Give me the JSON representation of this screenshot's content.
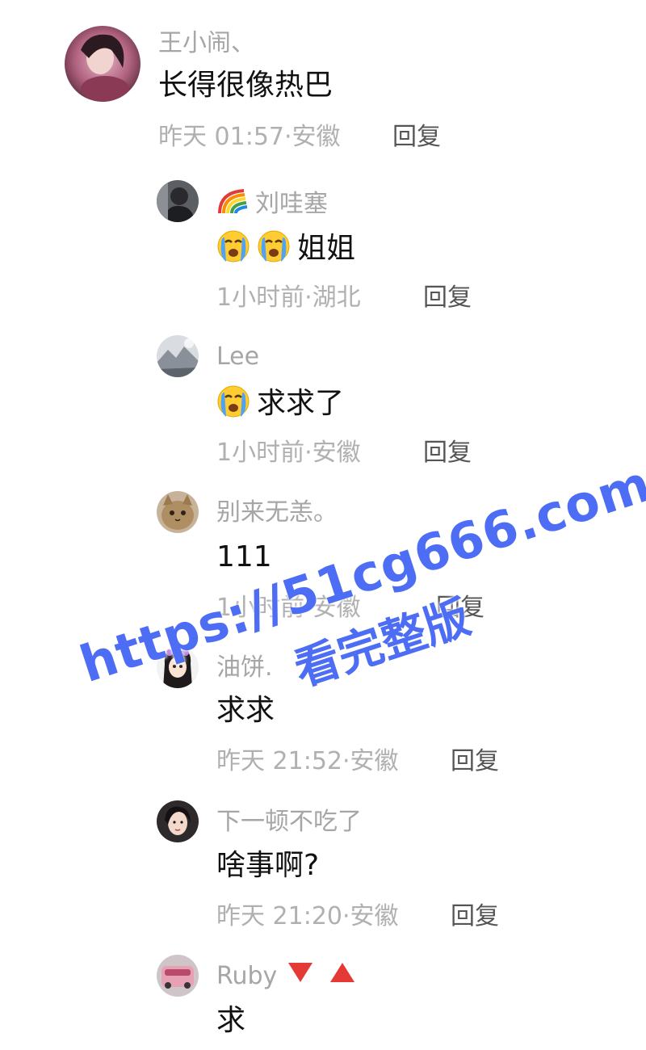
{
  "comments": [
    {
      "name": "王小闹、",
      "text": "长得很像热巴",
      "time": "昨天 01:57",
      "location": "安徽",
      "reply": "回复",
      "replies": [
        {
          "name": "刘哇塞",
          "name_prefix_icon": "rainbow-icon",
          "text": "姐姐",
          "text_emoji": [
            "crying-face",
            "crying-face"
          ],
          "time": "1小时前",
          "location": "湖北",
          "reply": "回复"
        },
        {
          "name": "Lee",
          "text": "求求了",
          "text_emoji": [
            "crying-face"
          ],
          "time": "1小时前",
          "location": "安徽",
          "reply": "回复"
        },
        {
          "name": "别来无恙。",
          "text": "111",
          "time": "1小时前",
          "location": "安徽",
          "reply": "回复"
        },
        {
          "name": "油饼.",
          "text": "求求",
          "time": "昨天 21:52",
          "location": "安徽",
          "reply": "回复"
        },
        {
          "name": "下一顿不吃了",
          "text": "啥事啊?",
          "time": "昨天 21:20",
          "location": "安徽",
          "reply": "回复"
        },
        {
          "name": "Ruby",
          "name_suffix_icons": [
            "red-down-triangle",
            "red-up-triangle"
          ],
          "text": "求"
        }
      ]
    }
  ],
  "separator": "·",
  "watermark": {
    "url": "https://51cg666.com",
    "subtitle": "看完整版",
    "color": "#4e6df5"
  }
}
